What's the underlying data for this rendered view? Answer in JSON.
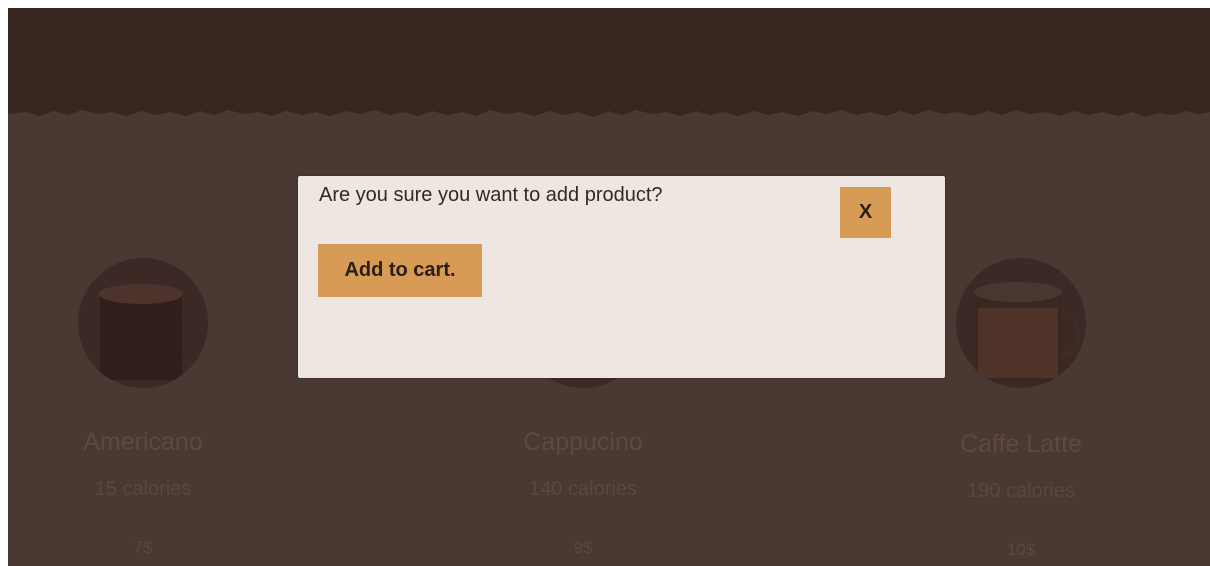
{
  "modal": {
    "message": "Are you sure you want to add product?",
    "close_label": "X",
    "add_label": "Add to cart."
  },
  "products": [
    {
      "name": "Americano",
      "calories": "15 calories",
      "price": "7$",
      "icon": "coffee-mug-icon"
    },
    {
      "name": "Cappucino",
      "calories": "140 calories",
      "price": "9$",
      "icon": "coffee-mug-icon"
    },
    {
      "name": "Caffe Latte",
      "calories": "190 calories",
      "price": "10$",
      "icon": "coffee-mug-icon"
    }
  ],
  "colors": {
    "background": "#4a3832",
    "header": "#38251f",
    "modal_background": "#eee6e1",
    "accent_button": "#d89b55",
    "text_dark": "#2f2a27"
  }
}
